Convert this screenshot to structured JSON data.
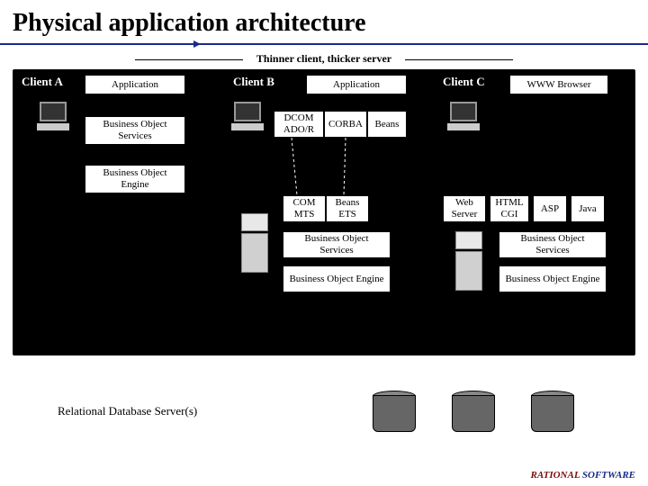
{
  "title": "Physical application architecture",
  "spectrum_label": "Thinner client, thicker server",
  "columns": {
    "a": {
      "head": "Client A",
      "app": "Application",
      "bos": "Business Object Services",
      "boe": "Business Object Engine"
    },
    "b": {
      "head": "Client B",
      "app": "Application",
      "dcom": "DCOM ADO/R",
      "corba": "CORBA",
      "beans": "Beans",
      "com": "COM MTS",
      "beans_ets": "Beans ETS",
      "bos": "Business Object Services",
      "boe": "Business Object Engine"
    },
    "c": {
      "head": "Client C",
      "browser": "WWW Browser",
      "web_server": "Web Server",
      "html": "HTML CGI",
      "asp": "ASP",
      "java": "Java",
      "bos": "Business Object Services",
      "boe": "Business Object Engine"
    }
  },
  "db_label": "Relational Database Server(s)",
  "logo": {
    "part1": "RATIONAL",
    "part2": " SOFTWARE"
  }
}
